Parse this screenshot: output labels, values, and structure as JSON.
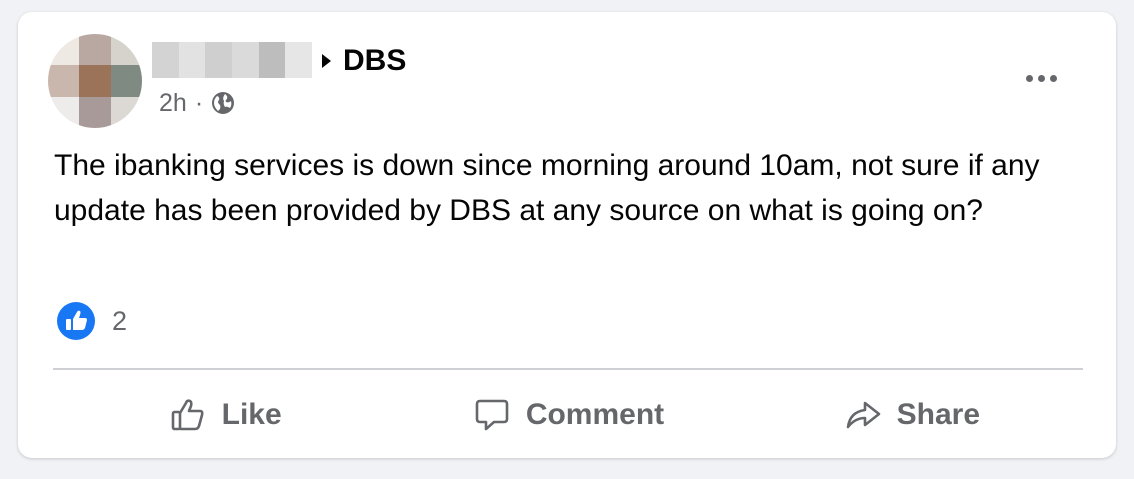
{
  "post": {
    "group_name": "DBS",
    "time": "2h",
    "separator": "·",
    "visibility_icon": "globe-icon",
    "text": "The ibanking services is down since morning around 10am, not sure if any update has been provided by DBS at any source on what is going on?",
    "reaction_icon": "like-badge-icon",
    "reaction_count": "2"
  },
  "actions": {
    "like_label": "Like",
    "comment_label": "Comment",
    "share_label": "Share"
  },
  "colors": {
    "background": "#f0f2f5",
    "card": "#ffffff",
    "secondary_text": "#65676b",
    "like_blue": "#1877f2"
  }
}
